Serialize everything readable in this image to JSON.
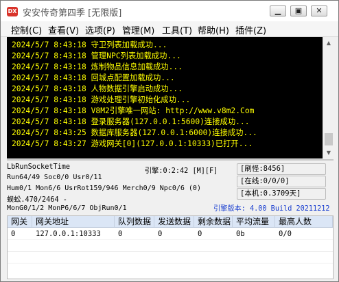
{
  "window": {
    "title": "安安传奇第四季 [无限版]",
    "icon_text": "DX",
    "buttons": [
      "minimize-icon",
      "maximize-icon",
      "close-icon"
    ]
  },
  "menu": [
    "控制(C)",
    "查看(V)",
    "选项(P)",
    "管理(M)",
    "工具(T)",
    "帮助(H)",
    "插件(Z)"
  ],
  "console": {
    "lines": [
      "2024/5/7 8:43:18 守卫列表加载成功...",
      "2024/5/7 8:43:18 管理NPC列表加载成功...",
      "2024/5/7 8:43:18 炼制物品信息加载成功...",
      "2024/5/7 8:43:18 回城点配置加载成功...",
      "2024/5/7 8:43:18 人物数据引擎启动成功...",
      "2024/5/7 8:43:18 游戏处理引擎初始化成功...",
      "2024/5/7 8:43:18 V8M2引擎唯一网站: http://www.v8m2.Com",
      "2024/5/7 8:43:18 登录服务器(127.0.0.1:5600)连接成功...",
      "2024/5/7 8:43:25 数据库服务器(127.0.0.1:6000)连接成功...",
      "2024/5/7 8:43:27 游戏网关[0](127.0.0.1:10333)已打开..."
    ],
    "text_color": "#ffff00",
    "background": "#000000"
  },
  "status": {
    "socket": "LbRunSocketTime",
    "engine": "引擎:0:2:42 [M][F]",
    "run": "Run64/49 Soc0/0 Usr0/11",
    "hum": "Hum0/1 Mon6/6 UsrRot159/946 Merch0/9 Npc0/6 (0)",
    "centipede": "蜈蚣.470/2464 -",
    "mon": "MonG0/1/2 MonP6/6/7 ObjRun0/1",
    "refresh_monster": "[刷怪:8456]",
    "online": "[在线:0/0/0]",
    "local": "[本机:0.3709天]",
    "version": "引擎版本: 4.00 Build 20211212",
    "version_color": "#1a3fd0"
  },
  "table": {
    "headers": [
      "网关",
      "网关地址",
      "队列数据",
      "发送数据",
      "剩余数据",
      "平均流量",
      "最高人数"
    ],
    "rows": [
      [
        "0",
        "127.0.0.1:10333",
        "0",
        "0",
        "0",
        "0b",
        "0/0"
      ]
    ],
    "header_color": "#dbe6f6"
  }
}
